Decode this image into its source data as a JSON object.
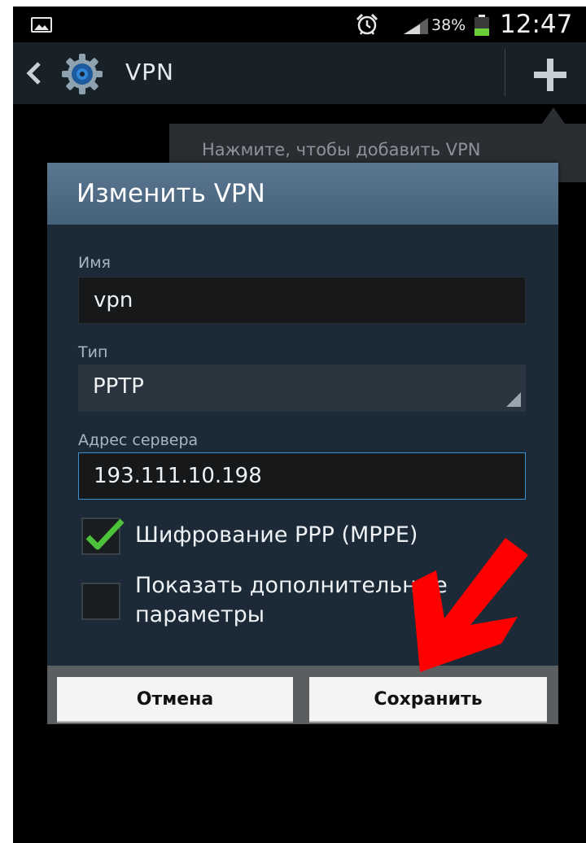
{
  "status_bar": {
    "battery_percent": "38%",
    "battery_level": 0.38,
    "time": "12:47",
    "icons": [
      "gallery-icon",
      "alarm-icon",
      "signal-icon",
      "battery-icon"
    ]
  },
  "action_bar": {
    "title": "VPN",
    "icons": [
      "back-chevron-icon",
      "settings-gear-icon",
      "add-plus-icon"
    ]
  },
  "tooltip": {
    "text": "Нажмите, чтобы добавить VPN"
  },
  "dialog": {
    "title": "Изменить VPN",
    "name_label": "Имя",
    "name_value": "vpn",
    "type_label": "Тип",
    "type_value": "PPTP",
    "server_label": "Адрес сервера",
    "server_value": "193.111.10.198",
    "encryption_label": "Шифрование PPP (MPPE)",
    "encryption_checked": true,
    "advanced_label_line1": "Показать дополнительные",
    "advanced_label_line2": "параметры",
    "advanced_checked": false,
    "cancel_label": "Отмена",
    "save_label": "Сохранить"
  },
  "colors": {
    "accent": "#3c8fd0",
    "check": "#4cc23a",
    "annotation_arrow": "#ff0000"
  }
}
